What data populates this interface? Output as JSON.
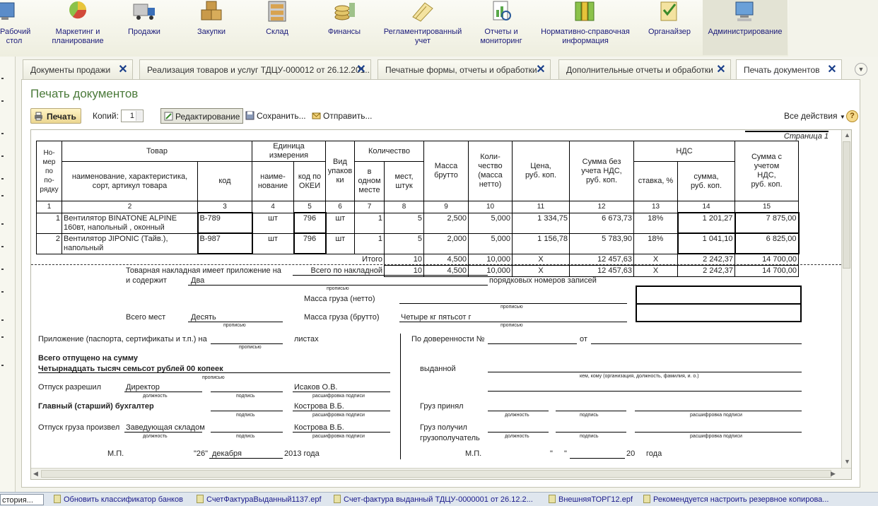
{
  "sections": [
    {
      "label": "Рабочий\nстол",
      "icon": "desktop-icon"
    },
    {
      "label": "Маркетинг и\nпланирование",
      "icon": "marketing-chart-icon"
    },
    {
      "label": "Продажи",
      "icon": "truck-icon"
    },
    {
      "label": "Закупки",
      "icon": "boxes-icon"
    },
    {
      "label": "Склад",
      "icon": "warehouse-icon"
    },
    {
      "label": "Финансы",
      "icon": "coins-icon"
    },
    {
      "label": "Регламентированный\nучет",
      "icon": "papers-icon"
    },
    {
      "label": "Отчеты и\nмониторинг",
      "icon": "report-icon"
    },
    {
      "label": "Нормативно-справочная\nинформация",
      "icon": "binders-icon"
    },
    {
      "label": "Органайзер",
      "icon": "organizer-icon"
    },
    {
      "label": "Администрирование",
      "icon": "computer-icon"
    }
  ],
  "tabs": [
    {
      "label": "Документы продажи"
    },
    {
      "label": "Реализация товаров и услуг ТДЦУ-000012 от 26.12.201..."
    },
    {
      "label": "Печатные формы, отчеты и обработки"
    },
    {
      "label": "Дополнительные отчеты и обработки"
    },
    {
      "label": "Печать документов"
    }
  ],
  "page": {
    "title": "Печать документов"
  },
  "toolbar": {
    "print": "Печать",
    "copies_label": "Копий:",
    "copies_value": "1",
    "edit": "Редактирование",
    "save": "Сохранить...",
    "send": "Отправить...",
    "all_actions": "Все действия",
    "help": "?"
  },
  "doc": {
    "page_label": "Страница 1",
    "headers": {
      "num": "Но-\nмер\nпо\nпо-\nрядку",
      "goods": "Товар",
      "goods_name": "наименование, характеристика,\nсорт, артикул товара",
      "goods_code": "код",
      "unit": "Единица измерения",
      "unit_name": "наиме-\nнование",
      "unit_okei": "код по\nОКЕИ",
      "pack": "Вид\nупаков\nки",
      "qty": "Количество",
      "qty_one": "в\nодном\nместе",
      "qty_places": "мест,\nштук",
      "gross": "Масса\nбрутто",
      "net": "Коли-\nчество\n(масса\nнетто)",
      "price": "Цена,\nруб. коп.",
      "sum_novat": "Сумма без\nучета НДС,\nруб. коп.",
      "vat": "НДС",
      "vat_rate": "ставка, %",
      "vat_sum": "сумма,\nруб. коп.",
      "sum_vat": "Сумма с\nучетом\nНДС,\nруб. коп."
    },
    "col_nums": [
      "1",
      "2",
      "3",
      "4",
      "5",
      "6",
      "7",
      "8",
      "9",
      "10",
      "11",
      "12",
      "13",
      "14",
      "15"
    ],
    "rows": [
      {
        "n": "1",
        "name": "Вентилятор BINATONE ALPINE 160вт, напольный , оконный",
        "code": "В-789",
        "unit": "шт",
        "okei": "796",
        "pack": "шт",
        "one": "1",
        "places": "5",
        "gross": "2,500",
        "net": "5,000",
        "price": "1 334,75",
        "sum": "6 673,73",
        "rate": "18%",
        "vat": "1 201,27",
        "total": "7 875,00"
      },
      {
        "n": "2",
        "name": "Вентилятор JIPONIC (Тайв.), напольный",
        "code": "В-987",
        "unit": "шт",
        "okei": "796",
        "pack": "шт",
        "one": "1",
        "places": "5",
        "gross": "2,000",
        "net": "5,000",
        "price": "1 156,78",
        "sum": "5 783,90",
        "rate": "18%",
        "vat": "1 041,10",
        "total": "6 825,00"
      }
    ],
    "totals": [
      {
        "label": "Итого",
        "places": "10",
        "gross": "4,500",
        "net": "10,000",
        "price": "X",
        "sum": "12 457,63",
        "rate": "X",
        "vat": "2 242,37",
        "total": "14 700,00"
      },
      {
        "label": "Всего по накладной",
        "places": "10",
        "gross": "4,500",
        "net": "10,000",
        "price": "X",
        "sum": "12 457,63",
        "rate": "X",
        "vat": "2 242,37",
        "total": "14 700,00"
      }
    ],
    "footer": {
      "attach_1": "Товарная накладная имеет приложение на",
      "attach_2": "и содержит",
      "attach_count": "Два",
      "records": "порядковых номеров записей",
      "propisyu": "прописью",
      "mass_net": "Масса груза (нетто)",
      "mass_gross": "Масса груза (брутто)",
      "mass_gross_val": "Четыре кг пятьсот г",
      "places_label": "Всего мест",
      "places_val": "Десять",
      "appendix": "Приложение (паспорта, сертификаты и т.п.) на",
      "sheets": "листах",
      "released_sum": "Всего отпущено  на сумму",
      "released_sum_val": "Четырнадцать тысяч семьсот рублей 00 копеек",
      "allowed": "Отпуск разрешил",
      "allowed_pos": "Директор",
      "allowed_name": "Исаков О.В.",
      "position": "должность",
      "signature": "подпись",
      "decode": "расшифровка подписи",
      "accountant": "Главный (старший) бухгалтер",
      "accountant_name": "Кострова В.Б.",
      "shipped": "Отпуск груза произвел",
      "shipped_pos": "Заведующая складом",
      "shipped_name": "Кострова В.Б.",
      "mp": "М.П.",
      "date_day": "\"26\"",
      "date_month": "декабря",
      "date_year": "2013 года",
      "proxy": "По доверенности №",
      "from": "от",
      "issued": "выданной",
      "issued_hint": "кем, кому (организация, должность, фамилия, и. о.)",
      "cargo_accepted": "Груз принял",
      "cargo_received_1": "Груз получил",
      "cargo_received_2": "грузополучатель",
      "mp2": "М.П.",
      "date2_q1": "\"",
      "date2_q2": "\"",
      "date2_year": "20",
      "date2_suffix": "года"
    }
  },
  "taskbar": [
    {
      "label": "стория..."
    },
    {
      "label": "Обновить классификатор банков"
    },
    {
      "label": "СчетФактураВыданный1137.epf"
    },
    {
      "label": "Счет-фактура выданный ТДЦУ-0000001 от 26.12.2..."
    },
    {
      "label": "ВнешняяТОРГ12.epf"
    },
    {
      "label": "Рекомендуется настроить резервное копирова..."
    }
  ]
}
